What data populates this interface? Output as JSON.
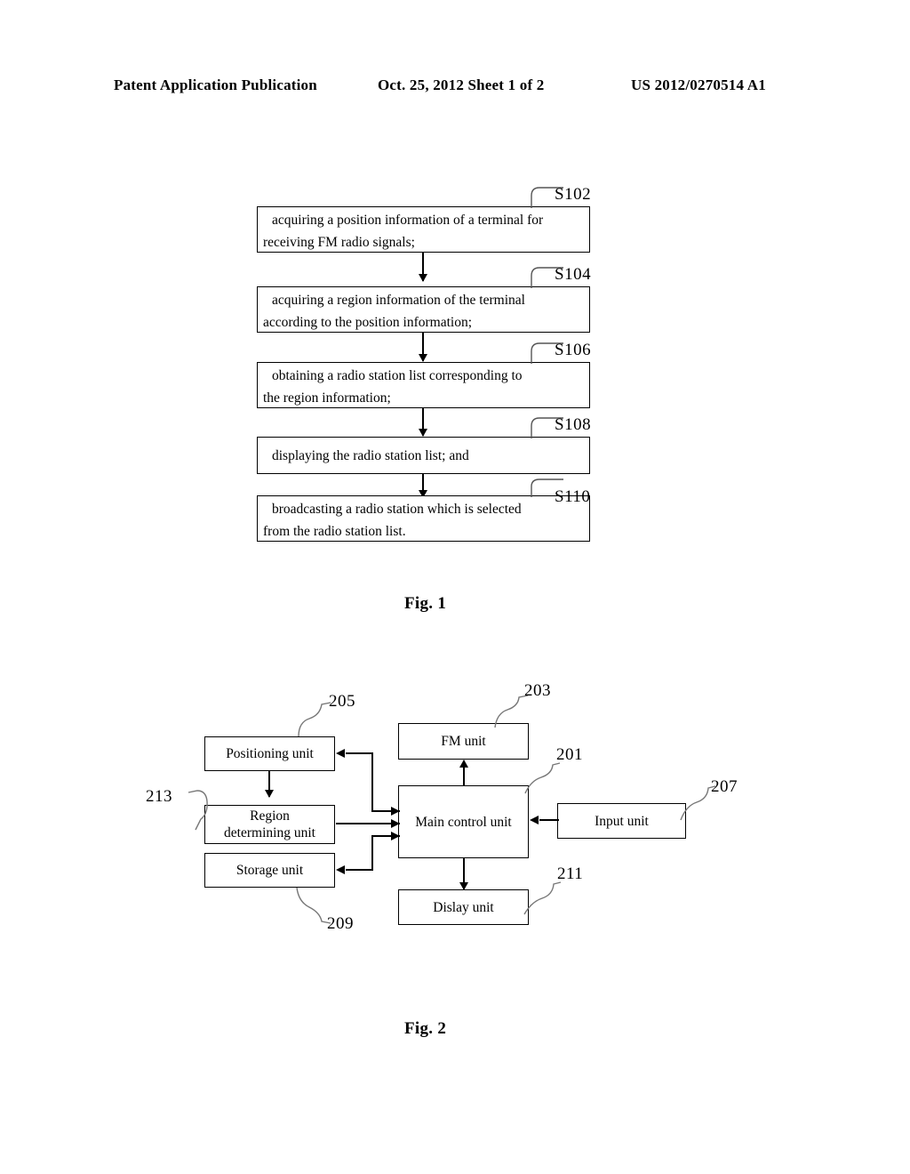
{
  "header": {
    "left": "Patent Application Publication",
    "middle": "Oct. 25, 2012  Sheet 1 of 2",
    "right": "US 2012/0270514 A1"
  },
  "figure1": {
    "caption": "Fig. 1",
    "steps": [
      {
        "ref": "S102",
        "line1": "acquiring a position information of a terminal for",
        "line2": "receiving FM radio signals;"
      },
      {
        "ref": "S104",
        "line1": "acquiring a region information of the terminal",
        "line2": "according to the position information;"
      },
      {
        "ref": "S106",
        "line1": "obtaining a radio station list corresponding to",
        "line2": "the region information;"
      },
      {
        "ref": "S108",
        "line1": "displaying the radio station list; and",
        "line2": ""
      },
      {
        "ref": "S110",
        "line1": "broadcasting a radio station which is selected",
        "line2": "from the radio station list."
      }
    ]
  },
  "figure2": {
    "caption": "Fig. 2",
    "blocks": {
      "positioning_unit": "Positioning unit",
      "region_determining_unit_line1": "Region",
      "region_determining_unit_line2": "determining unit",
      "storage_unit": "Storage unit",
      "fm_unit": "FM unit",
      "main_control_unit": "Main control unit",
      "display_unit": "Dislay unit",
      "input_unit": "Input unit"
    },
    "refs": {
      "positioning_unit": "205",
      "region_determining_unit": "213",
      "storage_unit": "209",
      "fm_unit": "203",
      "main_control_unit": "201",
      "display_unit": "211",
      "input_unit": "207"
    }
  },
  "colors": {
    "ink": "#000000",
    "paper": "#ffffff"
  }
}
